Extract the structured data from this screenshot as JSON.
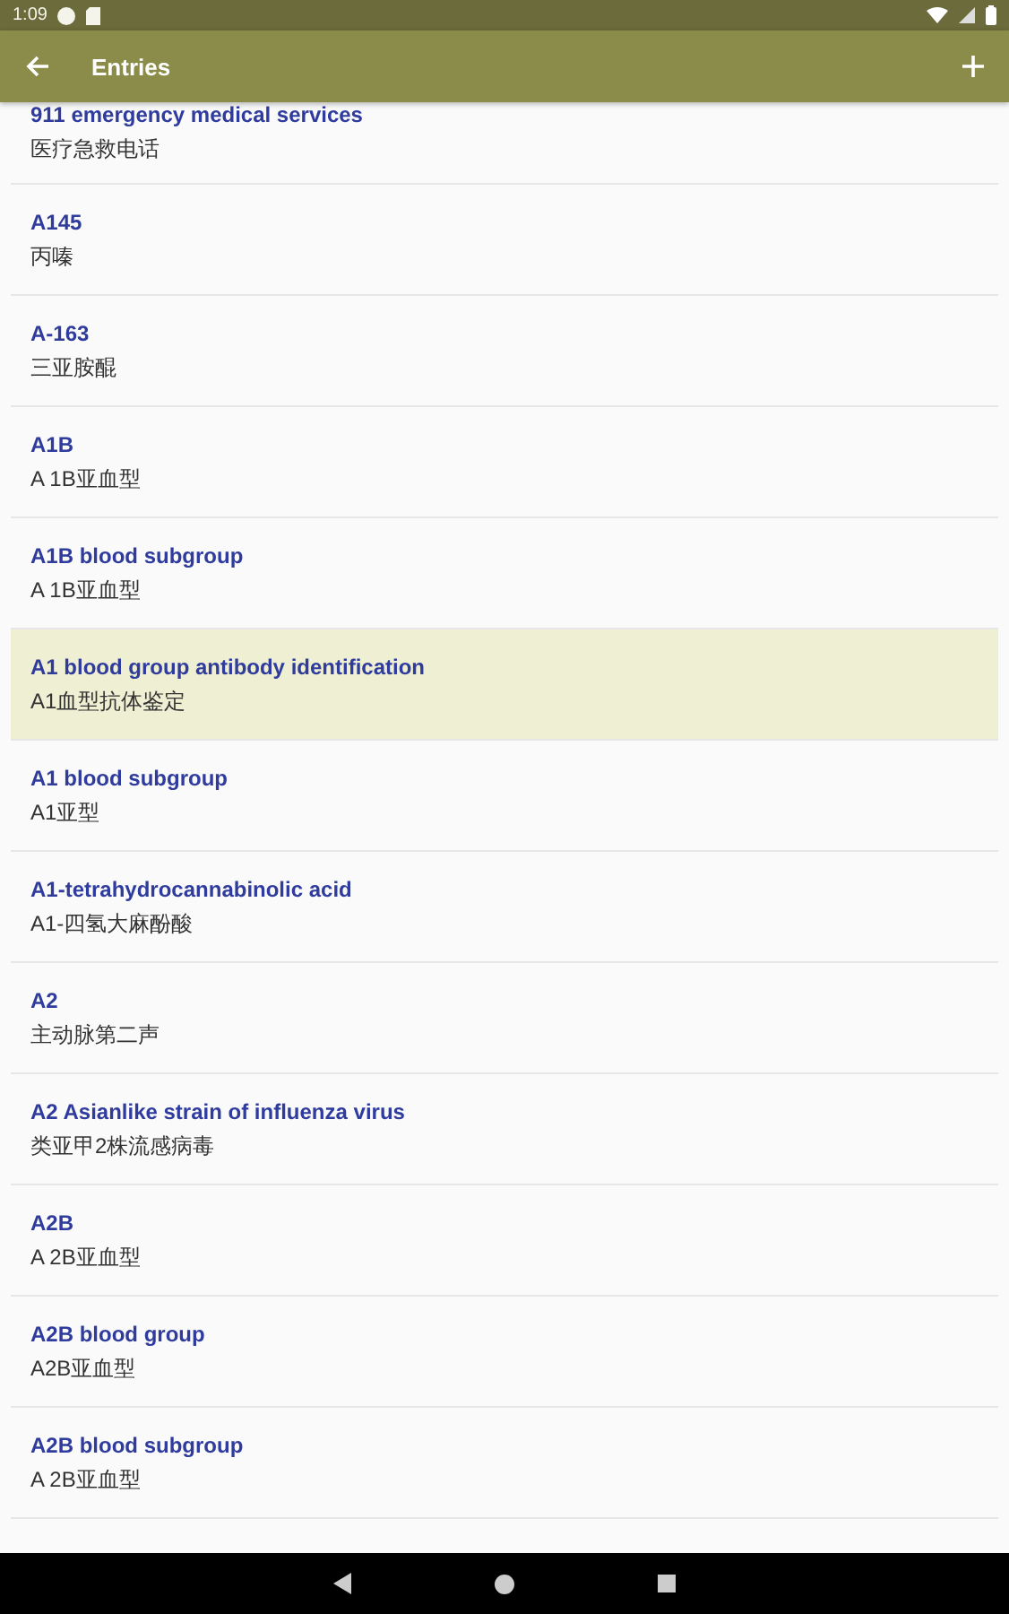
{
  "status_bar": {
    "time": "1:09"
  },
  "app_bar": {
    "title": "Entries"
  },
  "entries": [
    {
      "term": "911 emergency medical services",
      "translation": "医疗急救电话",
      "selected": false
    },
    {
      "term": "A145",
      "translation": "丙嗪",
      "selected": false
    },
    {
      "term": "A-163",
      "translation": "三亚胺醌",
      "selected": false
    },
    {
      "term": "A1B",
      "translation": "A 1B亚血型",
      "selected": false
    },
    {
      "term": "A1B blood subgroup",
      "translation": "A 1B亚血型",
      "selected": false
    },
    {
      "term": "A1 blood group antibody identification",
      "translation": "A1血型抗体鉴定",
      "selected": true
    },
    {
      "term": "A1 blood subgroup",
      "translation": "A1亚型",
      "selected": false
    },
    {
      "term": "A1-tetrahydrocannabinolic acid",
      "translation": "A1-四氢大麻酚酸",
      "selected": false
    },
    {
      "term": "A2",
      "translation": "主动脉第二声",
      "selected": false
    },
    {
      "term": "A2 Asianlike strain of influenza virus",
      "translation": "类亚甲2株流感病毒",
      "selected": false
    },
    {
      "term": "A2B",
      "translation": "A 2B亚血型",
      "selected": false
    },
    {
      "term": "A2B blood group",
      "translation": "A2B亚血型",
      "selected": false
    },
    {
      "term": "A2B blood subgroup",
      "translation": "A 2B亚血型",
      "selected": false
    }
  ]
}
